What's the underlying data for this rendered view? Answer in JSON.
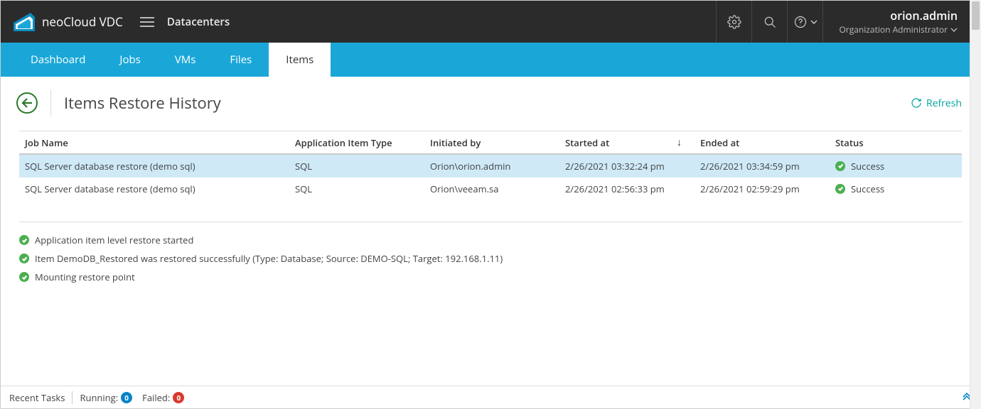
{
  "brand": "neoCloud VDC",
  "breadcrumb": "Datacenters",
  "user": {
    "name": "orion.admin",
    "role": "Organization Administrator"
  },
  "tabs": [
    {
      "label": "Dashboard"
    },
    {
      "label": "Jobs"
    },
    {
      "label": "VMs"
    },
    {
      "label": "Files"
    },
    {
      "label": "Items",
      "active": true
    }
  ],
  "page": {
    "title": "Items Restore History",
    "refresh": "Refresh"
  },
  "grid": {
    "columns": {
      "job": "Job Name",
      "type": "Application Item Type",
      "initiated": "Initiated by",
      "started": "Started at",
      "ended": "Ended at",
      "status": "Status"
    },
    "rows": [
      {
        "job": "SQL Server database restore (demo sql)",
        "type": "SQL",
        "initiated": "Orion\\orion.admin",
        "started": "2/26/2021 03:32:24 pm",
        "ended": "2/26/2021 03:34:59 pm",
        "status": "Success",
        "selected": true
      },
      {
        "job": "SQL Server database restore (demo sql)",
        "type": "SQL",
        "initiated": "Orion\\veeam.sa",
        "started": "2/26/2021 02:56:33 pm",
        "ended": "2/26/2021 02:59:29 pm",
        "status": "Success",
        "selected": false
      }
    ]
  },
  "log": [
    "Application item level restore started",
    "Item DemoDB_Restored was restored successfully (Type: Database; Source: DEMO-SQL; Target: 192.168.1.11)",
    "Mounting restore point"
  ],
  "statusbar": {
    "recent": "Recent Tasks",
    "running_label": "Running:",
    "running_count": "0",
    "failed_label": "Failed:",
    "failed_count": "0"
  }
}
